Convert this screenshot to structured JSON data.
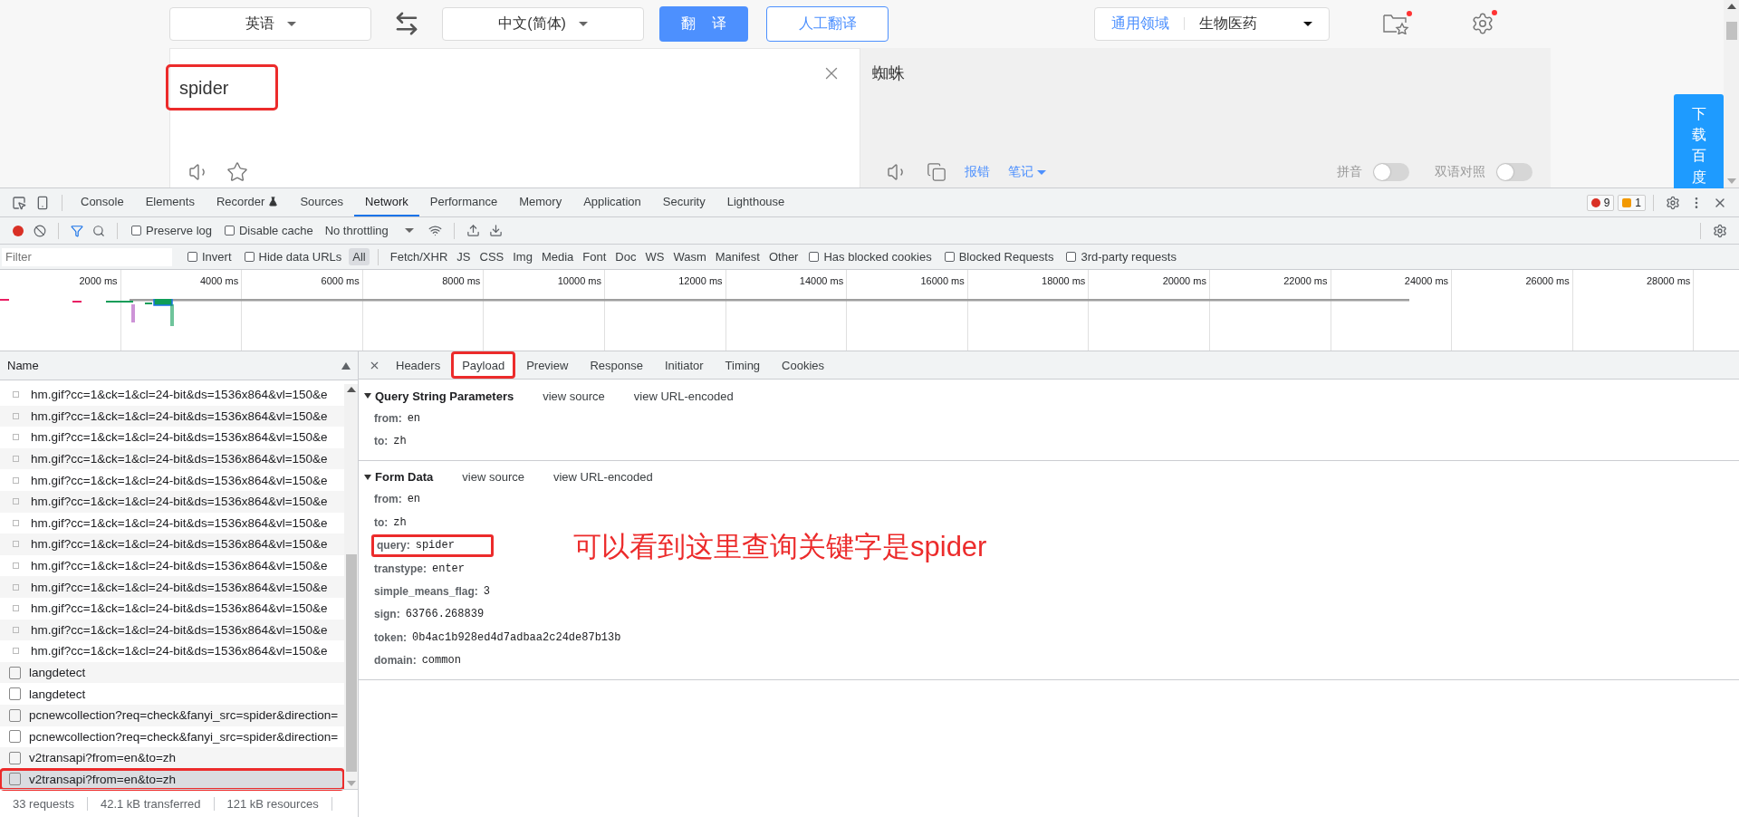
{
  "translator": {
    "source_language": "英语",
    "target_language": "中文(简体)",
    "translate_button": "翻 译",
    "human_button": "人工翻译",
    "domain": {
      "label": "通用领域",
      "value": "生物医药"
    },
    "input": {
      "value": "spider",
      "highlighted": true
    },
    "output": "蜘蛛",
    "output_links": [
      {
        "label": "报错",
        "kind": "link"
      },
      {
        "label": "笔记",
        "kind": "menu"
      }
    ],
    "toggles": [
      {
        "label": "拼音",
        "on": false
      },
      {
        "label": "双语对照",
        "on": false
      }
    ],
    "side_tab": "下载百度"
  },
  "devtools": {
    "tabs": [
      {
        "label": "Console",
        "selected": false
      },
      {
        "label": "Elements",
        "selected": false
      },
      {
        "label": "Recorder",
        "selected": false
      },
      {
        "label": "Sources",
        "selected": false
      },
      {
        "label": "Network",
        "selected": true
      },
      {
        "label": "Performance",
        "selected": false
      },
      {
        "label": "Memory",
        "selected": false
      },
      {
        "label": "Application",
        "selected": false
      },
      {
        "label": "Security",
        "selected": false
      },
      {
        "label": "Lighthouse",
        "selected": false
      }
    ],
    "issues": {
      "errors": "9",
      "warnings": "1"
    },
    "toolbar": {
      "recording": true,
      "checks": [
        {
          "label": "Preserve log",
          "checked": false
        },
        {
          "label": "Disable cache",
          "checked": false
        }
      ],
      "throttling": "No throttling"
    },
    "filter": {
      "placeholder": "Filter",
      "checks": [
        {
          "label": "Invert",
          "checked": false
        },
        {
          "label": "Hide data URLs",
          "checked": false
        }
      ],
      "types": [
        {
          "label": "All",
          "selected": true
        },
        {
          "label": "Fetch/XHR",
          "selected": false
        },
        {
          "label": "JS",
          "selected": false
        },
        {
          "label": "CSS",
          "selected": false
        },
        {
          "label": "Img",
          "selected": false
        },
        {
          "label": "Media",
          "selected": false
        },
        {
          "label": "Font",
          "selected": false
        },
        {
          "label": "Doc",
          "selected": false
        },
        {
          "label": "WS",
          "selected": false
        },
        {
          "label": "Wasm",
          "selected": false
        },
        {
          "label": "Manifest",
          "selected": false
        },
        {
          "label": "Other",
          "selected": false
        }
      ],
      "more_checks": [
        {
          "label": "Has blocked cookies",
          "checked": false
        },
        {
          "label": "Blocked Requests",
          "checked": false
        },
        {
          "label": "3rd-party requests",
          "checked": false
        }
      ]
    },
    "overview_ticks": [
      "2000 ms",
      "4000 ms",
      "6000 ms",
      "8000 ms",
      "10000 ms",
      "12000 ms",
      "14000 ms",
      "16000 ms",
      "18000 ms",
      "20000 ms",
      "22000 ms",
      "24000 ms",
      "26000 ms",
      "28000 ms"
    ],
    "requests": {
      "column": "Name",
      "rows": [
        {
          "name": "hm.gif?cc=1&ck=1&cl=24-bit&ds=1536x864&vl=150&e",
          "kind": "image",
          "selected": false,
          "highlighted": false
        },
        {
          "name": "hm.gif?cc=1&ck=1&cl=24-bit&ds=1536x864&vl=150&e",
          "kind": "image",
          "selected": false,
          "highlighted": false
        },
        {
          "name": "hm.gif?cc=1&ck=1&cl=24-bit&ds=1536x864&vl=150&e",
          "kind": "image",
          "selected": false,
          "highlighted": false
        },
        {
          "name": "hm.gif?cc=1&ck=1&cl=24-bit&ds=1536x864&vl=150&e",
          "kind": "image",
          "selected": false,
          "highlighted": false
        },
        {
          "name": "hm.gif?cc=1&ck=1&cl=24-bit&ds=1536x864&vl=150&e",
          "kind": "image",
          "selected": false,
          "highlighted": false
        },
        {
          "name": "hm.gif?cc=1&ck=1&cl=24-bit&ds=1536x864&vl=150&e",
          "kind": "image",
          "selected": false,
          "highlighted": false
        },
        {
          "name": "hm.gif?cc=1&ck=1&cl=24-bit&ds=1536x864&vl=150&e",
          "kind": "image",
          "selected": false,
          "highlighted": false
        },
        {
          "name": "hm.gif?cc=1&ck=1&cl=24-bit&ds=1536x864&vl=150&e",
          "kind": "image",
          "selected": false,
          "highlighted": false
        },
        {
          "name": "hm.gif?cc=1&ck=1&cl=24-bit&ds=1536x864&vl=150&e",
          "kind": "image",
          "selected": false,
          "highlighted": false
        },
        {
          "name": "hm.gif?cc=1&ck=1&cl=24-bit&ds=1536x864&vl=150&e",
          "kind": "image",
          "selected": false,
          "highlighted": false
        },
        {
          "name": "hm.gif?cc=1&ck=1&cl=24-bit&ds=1536x864&vl=150&e",
          "kind": "image",
          "selected": false,
          "highlighted": false
        },
        {
          "name": "hm.gif?cc=1&ck=1&cl=24-bit&ds=1536x864&vl=150&e",
          "kind": "image",
          "selected": false,
          "highlighted": false
        },
        {
          "name": "hm.gif?cc=1&ck=1&cl=24-bit&ds=1536x864&vl=150&e",
          "kind": "image",
          "selected": false,
          "highlighted": false
        },
        {
          "name": "langdetect",
          "kind": "document",
          "selected": false,
          "highlighted": false
        },
        {
          "name": "langdetect",
          "kind": "document",
          "selected": false,
          "highlighted": false
        },
        {
          "name": "pcnewcollection?req=check&fanyi_src=spider&direction=",
          "kind": "document",
          "selected": false,
          "highlighted": false
        },
        {
          "name": "pcnewcollection?req=check&fanyi_src=spider&direction=",
          "kind": "document",
          "selected": false,
          "highlighted": false
        },
        {
          "name": "v2transapi?from=en&to=zh",
          "kind": "document",
          "selected": false,
          "highlighted": false
        },
        {
          "name": "v2transapi?from=en&to=zh",
          "kind": "document",
          "selected": true,
          "highlighted": true
        }
      ]
    },
    "status": [
      "33 requests",
      "42.1 kB transferred",
      "121 kB resources"
    ],
    "detail_tabs": [
      {
        "label": "Headers",
        "selected": false,
        "highlighted": false
      },
      {
        "label": "Payload",
        "selected": true,
        "highlighted": true
      },
      {
        "label": "Preview",
        "selected": false,
        "highlighted": false
      },
      {
        "label": "Response",
        "selected": false,
        "highlighted": false
      },
      {
        "label": "Initiator",
        "selected": false,
        "highlighted": false
      },
      {
        "label": "Timing",
        "selected": false,
        "highlighted": false
      },
      {
        "label": "Cookies",
        "selected": false,
        "highlighted": false
      }
    ],
    "sections": [
      {
        "title": "Query String Parameters",
        "expanded": true,
        "links": [
          "view source",
          "view URL-encoded"
        ],
        "params": [
          {
            "key": "from:",
            "value": "en",
            "highlighted": false
          },
          {
            "key": "to:",
            "value": "zh",
            "highlighted": false
          }
        ]
      },
      {
        "title": "Form Data",
        "expanded": true,
        "links": [
          "view source",
          "view URL-encoded"
        ],
        "params": [
          {
            "key": "from:",
            "value": "en",
            "highlighted": false
          },
          {
            "key": "to:",
            "value": "zh",
            "highlighted": false
          },
          {
            "key": "query:",
            "value": "spider",
            "highlighted": true,
            "note": "可以看到这里查询关键字是spider"
          },
          {
            "key": "transtype:",
            "value": "enter",
            "highlighted": false
          },
          {
            "key": "simple_means_flag:",
            "value": "3",
            "highlighted": false
          },
          {
            "key": "sign:",
            "value": "63766.268839",
            "highlighted": false
          },
          {
            "key": "token:",
            "value": "0b4ac1b928ed4d7adbaa2c24de87b13b",
            "highlighted": false
          },
          {
            "key": "domain:",
            "value": "common",
            "highlighted": false
          }
        ]
      }
    ]
  }
}
